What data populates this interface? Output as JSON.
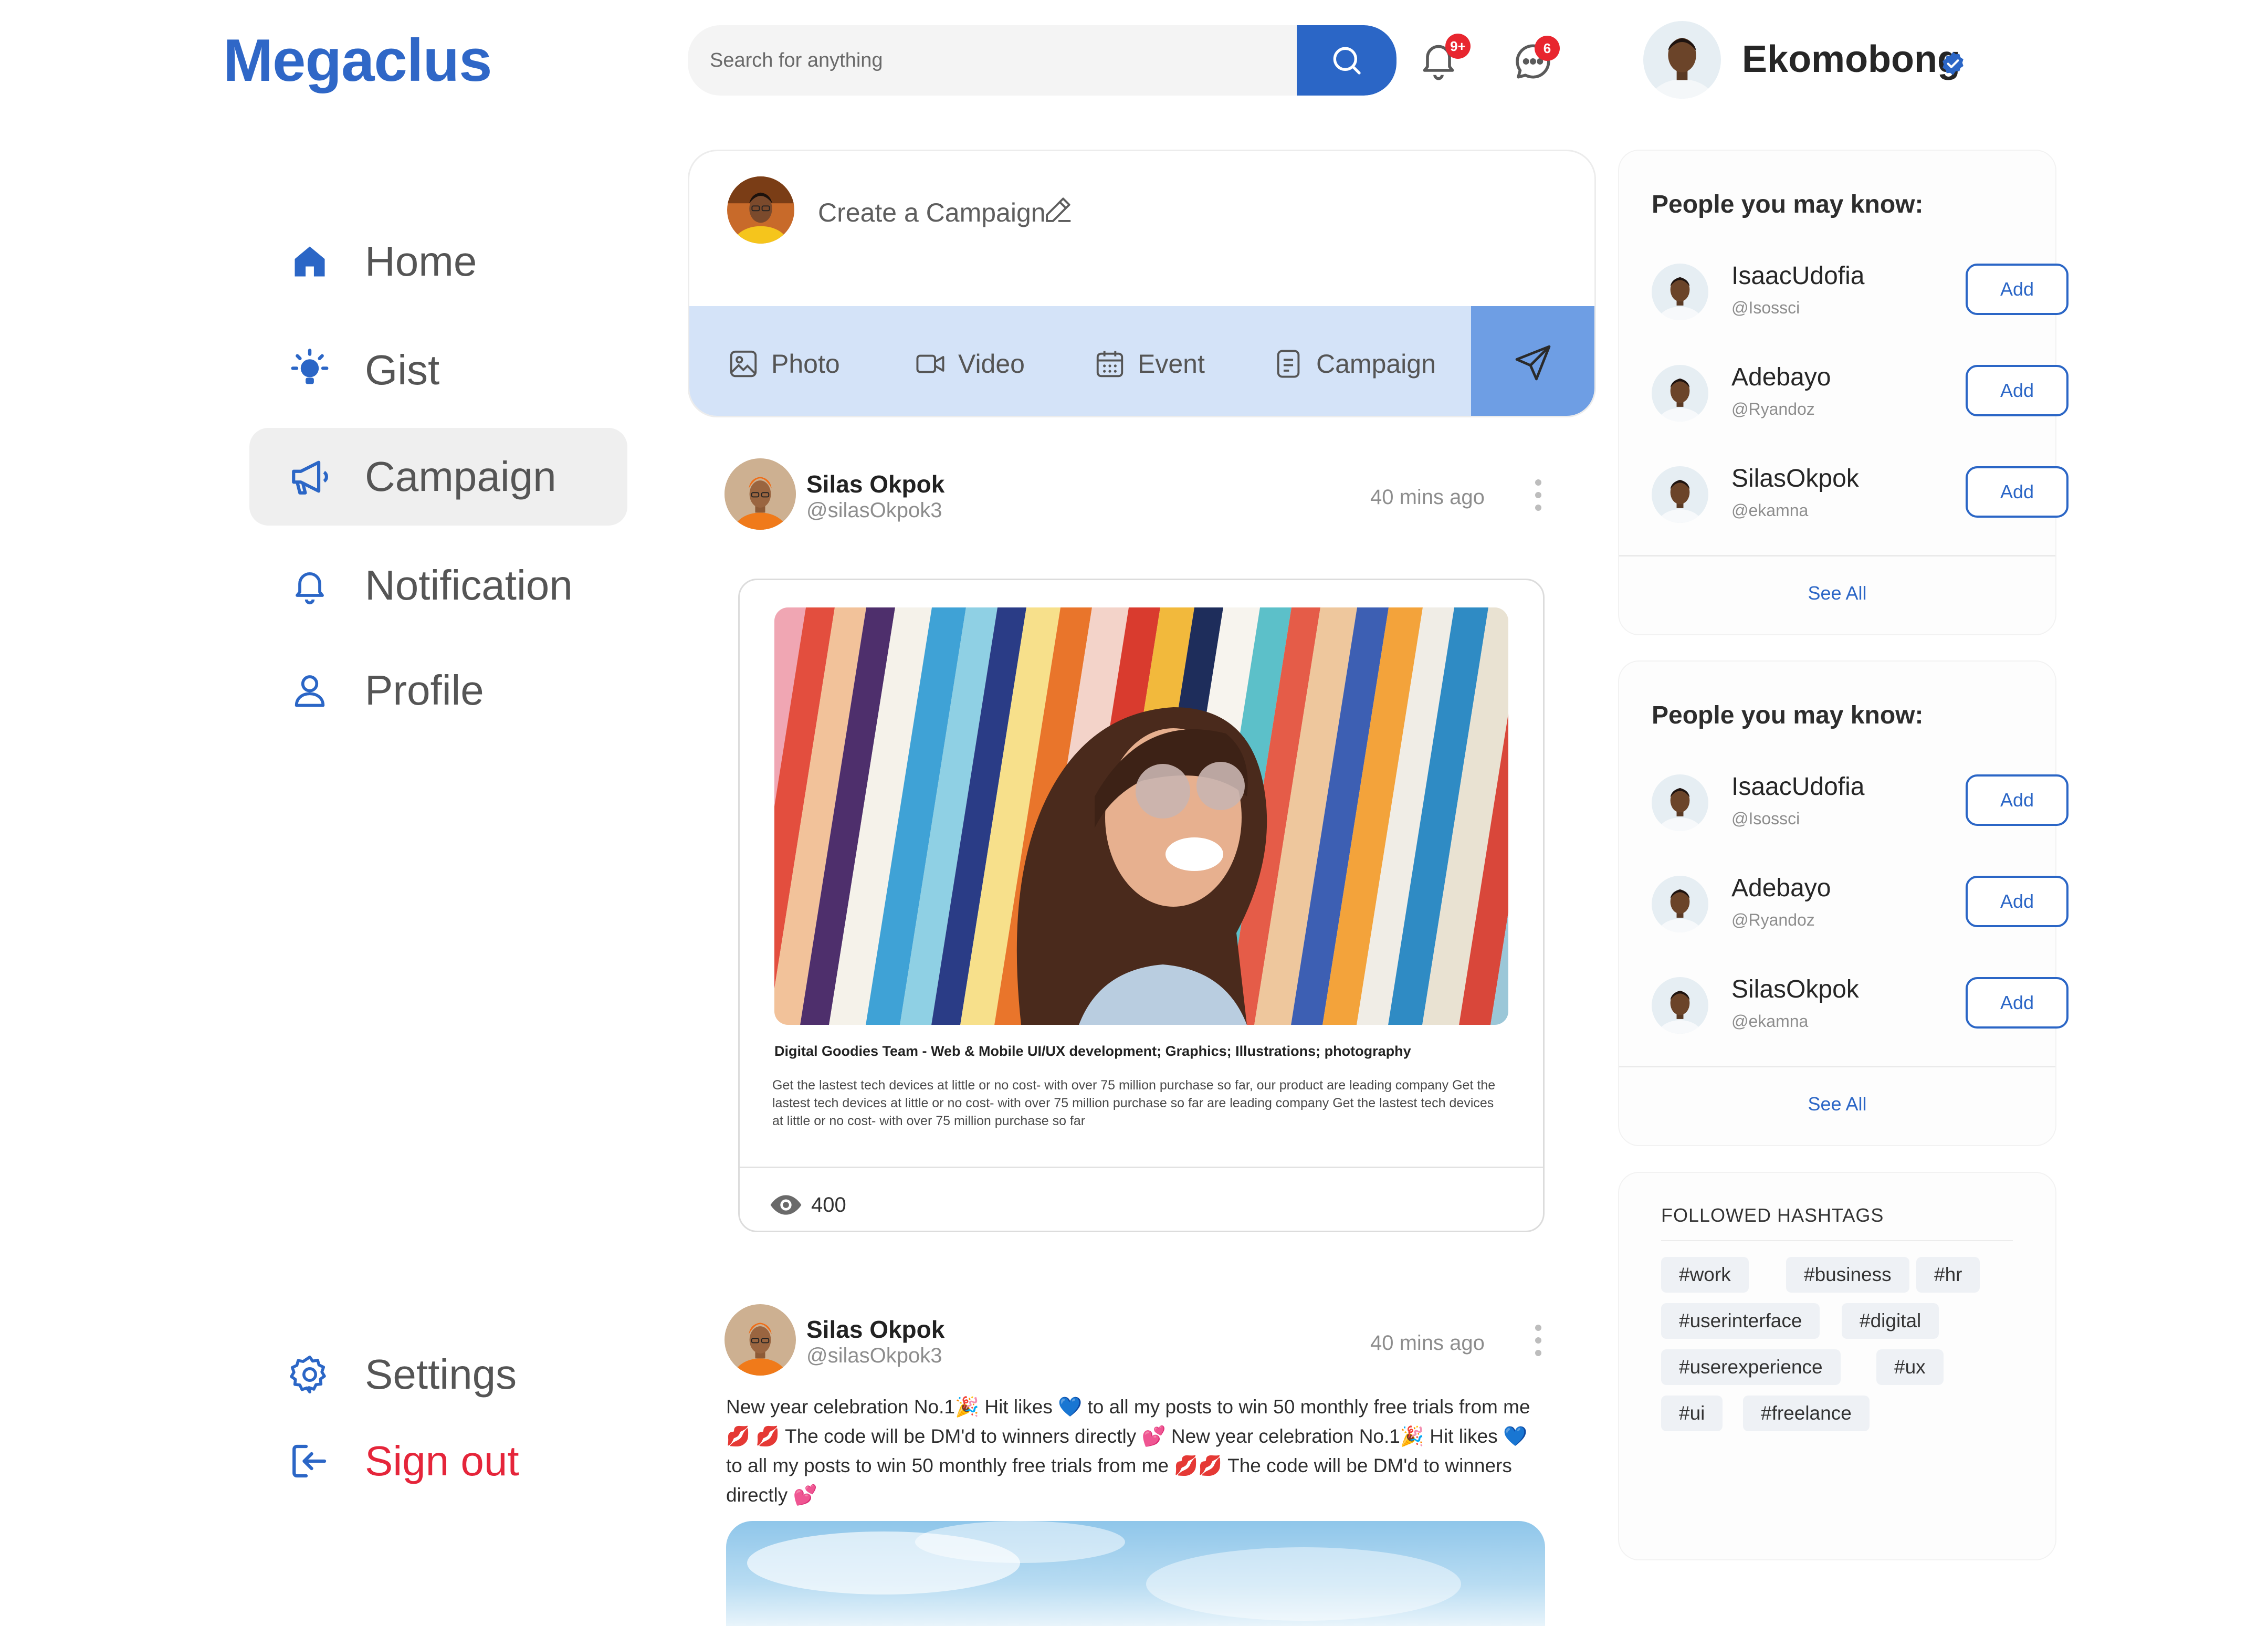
{
  "app": {
    "brand": "Megaclus"
  },
  "header": {
    "search_placeholder": "Search for anything",
    "notifications_badge": "9+",
    "messages_badge": "6",
    "user_name": "Ekomobong",
    "accent_color": "#2b66c6"
  },
  "sidebar": {
    "items": [
      {
        "label": "Home",
        "icon": "home-icon"
      },
      {
        "label": "Gist",
        "icon": "bulb-icon"
      },
      {
        "label": "Campaign",
        "icon": "megaphone-icon",
        "active": true
      },
      {
        "label": "Notification",
        "icon": "bell-icon"
      },
      {
        "label": "Profile",
        "icon": "user-icon"
      }
    ],
    "settings_label": "Settings",
    "signout_label": "Sign out"
  },
  "composer": {
    "prompt": "Create a Campaign",
    "tools": [
      "Photo",
      "Video",
      "Event",
      "Campaign"
    ]
  },
  "posts": [
    {
      "author": "Silas Okpok",
      "handle": "@silasOkpok3",
      "time": "40 mins ago",
      "card_title": "Digital Goodies Team - Web & Mobile UI/UX development; Graphics; Illustrations; photography",
      "card_body": "Get the lastest tech devices at little or no cost- with over 75 million purchase so far, our product are leading company Get the lastest tech devices at little or no cost- with over 75 million purchase so far are leading company Get the lastest tech devices at little or no cost- with over 75 million purchase so far",
      "views": "400"
    },
    {
      "author": "Silas Okpok",
      "handle": "@silasOkpok3",
      "time": "40 mins ago",
      "text": "New year celebration No.1🎉 Hit likes 💙 to all my posts to win 50 monthly free trials from me 💋 💋 The code will be DM'd to winners directly 💕 New year celebration No.1🎉 Hit likes 💙 to all my posts to win 50 monthly free trials from me 💋💋 The code will be DM'd to winners directly 💕"
    }
  ],
  "suggestions": [
    {
      "title": "People you may know:",
      "people": [
        {
          "name": "IsaacUdofia",
          "handle": "@Isossci",
          "action": "Add"
        },
        {
          "name": "Adebayo",
          "handle": "@Ryandoz",
          "action": "Add"
        },
        {
          "name": "SilasOkpok",
          "handle": "@ekamna",
          "action": "Add"
        }
      ],
      "see_all": "See All"
    },
    {
      "title": "People you may know:",
      "people": [
        {
          "name": "IsaacUdofia",
          "handle": "@Isossci",
          "action": "Add"
        },
        {
          "name": "Adebayo",
          "handle": "@Ryandoz",
          "action": "Add"
        },
        {
          "name": "SilasOkpok",
          "handle": "@ekamna",
          "action": "Add"
        }
      ],
      "see_all": "See All"
    }
  ],
  "hashtags": {
    "title": "FOLLOWED HASHTAGS",
    "tags": [
      "#work",
      "#business",
      "#hr",
      "#userinterface",
      "#digital",
      "#userexperience",
      "#ux",
      "#ui",
      "#freelance"
    ]
  }
}
